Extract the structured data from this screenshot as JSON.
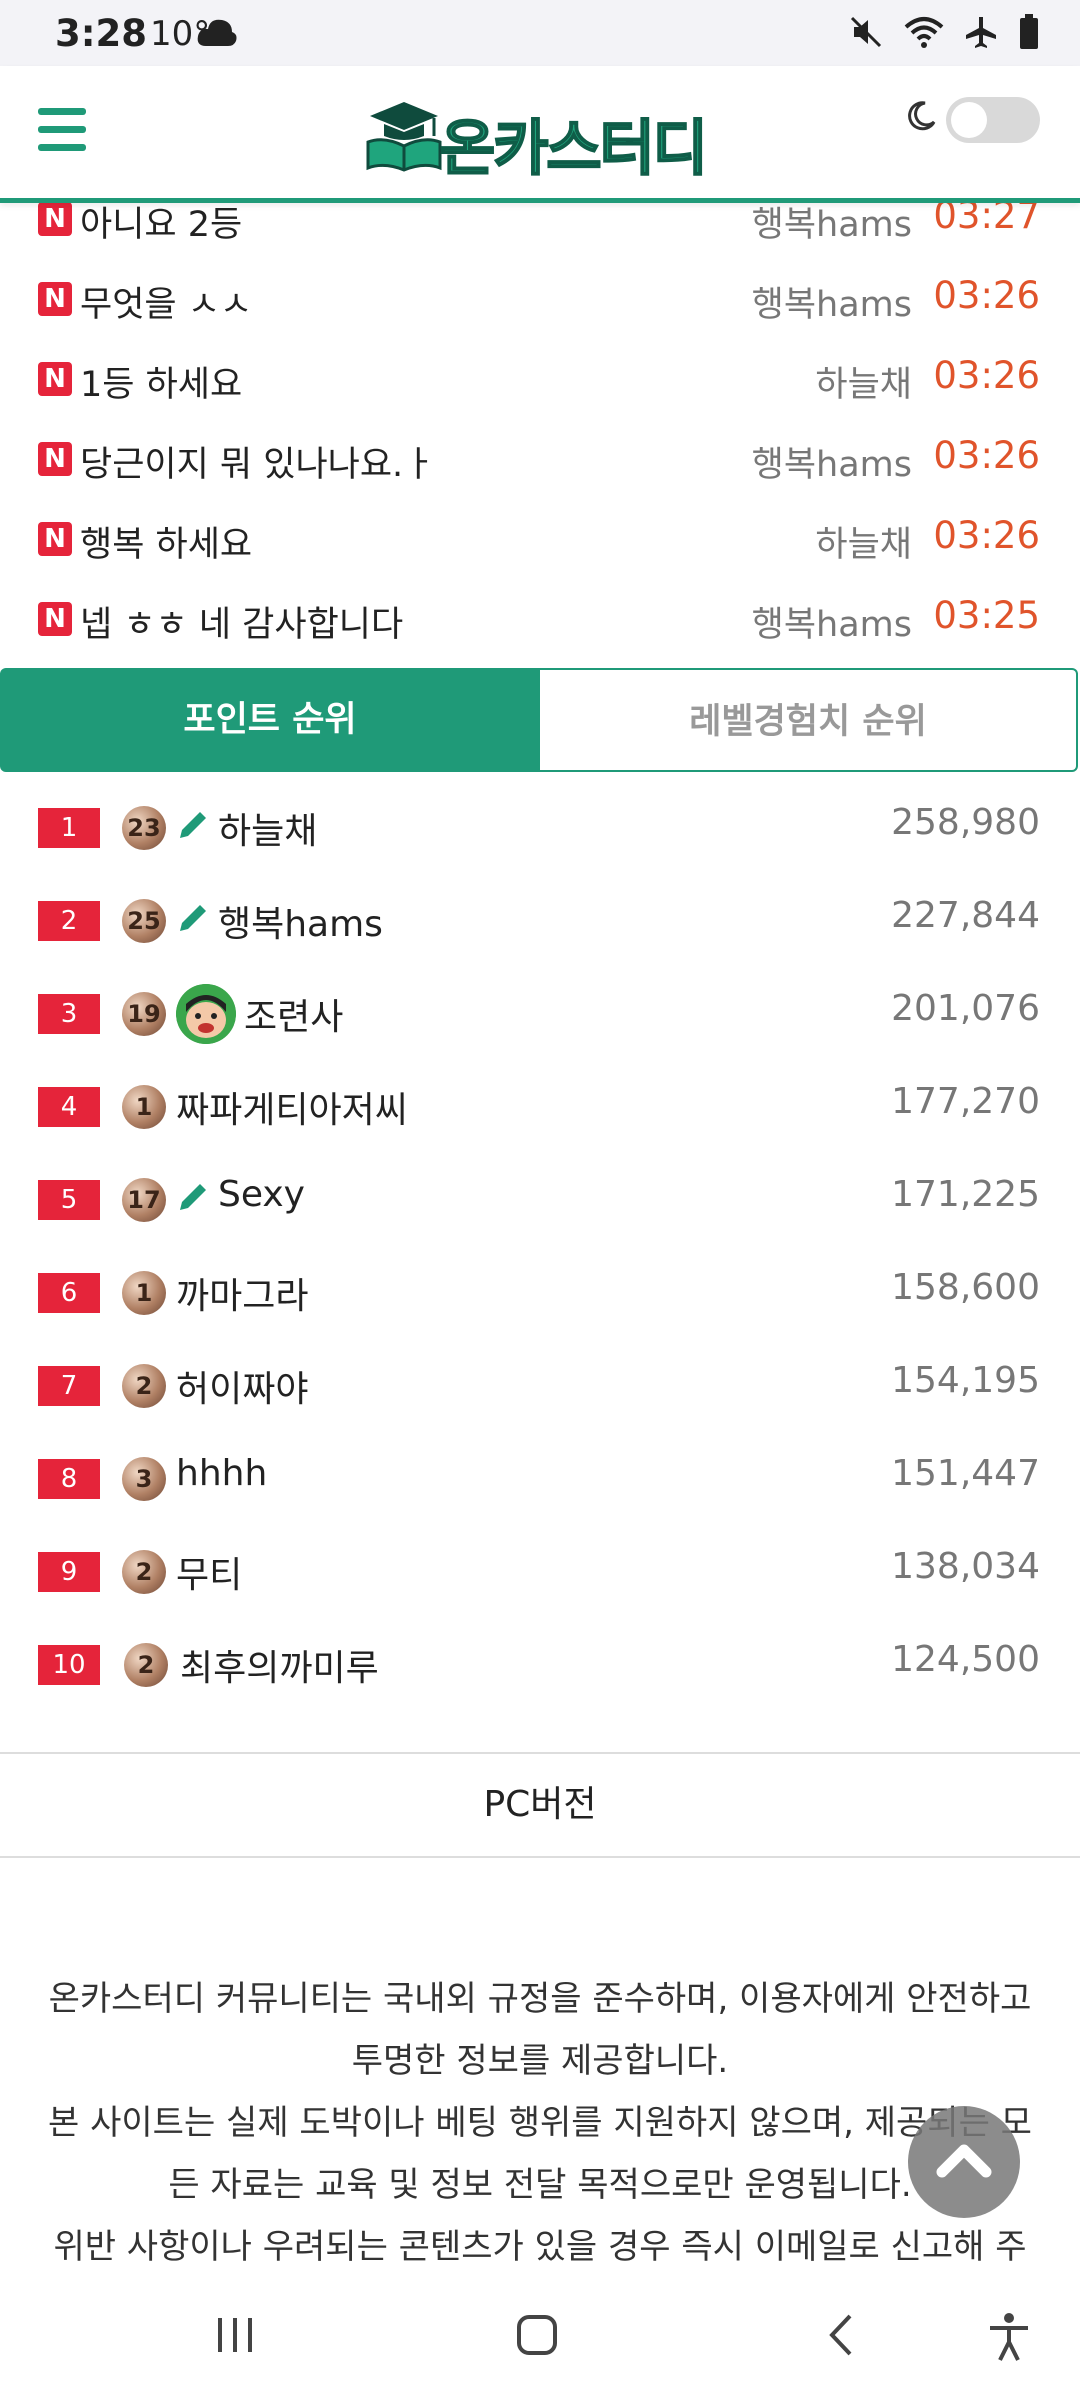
{
  "status_bar": {
    "time": "3:28",
    "temperature": "10°",
    "icons": [
      "cloud-icon",
      "mute-icon",
      "wifi-icon",
      "airplane-icon",
      "battery-icon"
    ]
  },
  "header": {
    "menu_icon": "hamburger-icon",
    "logo_text": "온카스터디",
    "theme_icon": "moon-icon",
    "accent_color": "#1f9a78"
  },
  "recent_comments": [
    {
      "title": "아니요 2등",
      "author": "행복hams",
      "time": "03:27"
    },
    {
      "title": "무엇을 ㅅㅅ",
      "author": "행복hams",
      "time": "03:26"
    },
    {
      "title": "1등 하세요",
      "author": "하늘채",
      "time": "03:26"
    },
    {
      "title": "당근이지 뭐 있나나요.ㅏ",
      "author": "행복hams",
      "time": "03:26"
    },
    {
      "title": "행복 하세요",
      "author": "하늘채",
      "time": "03:26"
    },
    {
      "title": "넵 ㅎㅎ 네 감사합니다",
      "author": "행복hams",
      "time": "03:25"
    }
  ],
  "tabs": [
    {
      "label": "포인트 순위",
      "active": true
    },
    {
      "label": "레벨경험치 순위",
      "active": false
    }
  ],
  "ranking": [
    {
      "rank": "1",
      "level": "23",
      "icon": "pencil-icon",
      "name": "하늘채",
      "points": "258,980"
    },
    {
      "rank": "2",
      "level": "25",
      "icon": "pencil-icon",
      "name": "행복hams",
      "points": "227,844"
    },
    {
      "rank": "3",
      "level": "19",
      "icon": "avatar",
      "name": "조련사",
      "points": "201,076"
    },
    {
      "rank": "4",
      "level": "1",
      "icon": "",
      "name": "짜파게티아저씨",
      "points": "177,270"
    },
    {
      "rank": "5",
      "level": "17",
      "icon": "pencil-icon",
      "name": "Sexy",
      "points": "171,225"
    },
    {
      "rank": "6",
      "level": "1",
      "icon": "",
      "name": "까마그라",
      "points": "158,600"
    },
    {
      "rank": "7",
      "level": "2",
      "icon": "",
      "name": "허이짜야",
      "points": "154,195"
    },
    {
      "rank": "8",
      "level": "3",
      "icon": "",
      "name": "hhhh",
      "points": "151,447"
    },
    {
      "rank": "9",
      "level": "2",
      "icon": "",
      "name": "무티",
      "points": "138,034"
    },
    {
      "rank": "10",
      "level": "2",
      "icon": "",
      "name": "최후의까미루",
      "points": "124,500"
    }
  ],
  "footer": {
    "pc_version": "PC버전",
    "lines": [
      "온카스터디 커뮤니티는 국내외 규정을 준수하며, 이용자에게 안전하고",
      "투명한 정보를 제공합니다.",
      "본 사이트는 실제 도박이나 베팅 행위를 지원하지 않으며, 제공되는 모",
      "든 자료는 교육 및 정보 전달 목적으로만 운영됩니다.",
      "위반 사항이나 우려되는 콘텐츠가 있을 경우 즉시 이메일로 신고해 주"
    ],
    "scroll_top_icon": "chevron-up-icon"
  },
  "nav_bar": {
    "buttons": [
      "recent-apps-icon",
      "home-icon",
      "back-icon",
      "accessibility-icon"
    ]
  }
}
